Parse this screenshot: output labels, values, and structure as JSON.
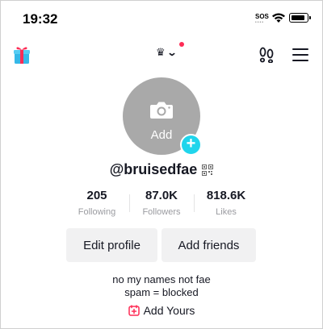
{
  "status_bar": {
    "time": "19:32",
    "sos_label": "SOS"
  },
  "top_nav": {
    "gift_icon": "gift-icon",
    "crown_icon": "crown-icon",
    "dropdown_icon": "chevron-down-icon",
    "footprints_icon": "footprints-icon",
    "menu_icon": "hamburger-menu-icon"
  },
  "profile": {
    "avatar_add_label": "Add",
    "username": "@bruisedfae",
    "stats": [
      {
        "value": "205",
        "label": "Following"
      },
      {
        "value": "87.0K",
        "label": "Followers"
      },
      {
        "value": "818.6K",
        "label": "Likes"
      }
    ],
    "buttons": {
      "edit_profile": "Edit profile",
      "add_friends": "Add friends"
    },
    "bio_lines": [
      "no my names not fae",
      "spam = blocked"
    ],
    "add_yours_label": "Add Yours"
  },
  "colors": {
    "accent_cyan": "#20d5ec",
    "accent_pink": "#fe2c55",
    "avatar_gray": "#a9a9a9",
    "button_gray": "#f1f1f2"
  }
}
